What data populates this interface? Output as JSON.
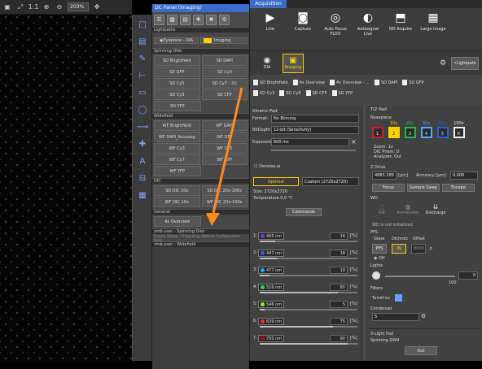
{
  "image_toolbar": {
    "zoom": "203%",
    "ratio": "1:1"
  },
  "dc_panel": {
    "title": "DC Panel (Imaging)",
    "groups": {
      "lightpaths": "Lightpaths",
      "spinning_disk": "Spinning Disk",
      "widefield": "Widefield",
      "dic": "DIC",
      "general": "General",
      "zmb_spinning": "zmb.user - Spinning Disk",
      "zmb_widefield": "zmb.user - Widefield"
    },
    "eyepiece": {
      "left": "Eyepiece - DIA",
      "right": "Imaging"
    },
    "spinning_buttons": [
      [
        "SD Brightfield",
        "SD DAPI"
      ],
      [
        "SD GFP",
        "SD Cy3"
      ],
      [
        "SD Cy5",
        "SD Cy7 - 2U"
      ],
      [
        "SD Cy3",
        "SD CFP"
      ],
      [
        "SD YFP",
        ""
      ]
    ],
    "widefield_buttons": [
      [
        "WF Brightfield",
        "WF DAPI"
      ],
      [
        "WF DAPI_focusing",
        "WF GFP"
      ],
      [
        "WF Cy3",
        "WF Cy5"
      ],
      [
        "WF Cy7",
        "WF CFP"
      ],
      [
        "WF YFP",
        ""
      ]
    ],
    "dic_buttons": [
      [
        "SD DIC 10x",
        "SD DIC 20x-100x"
      ],
      [
        "WF DIC 10x",
        "WF DIC 20x-100x"
      ]
    ],
    "general_buttons": [
      [
        "4x Overview",
        ""
      ]
    ],
    "empty_group_hint": "Empty Group - Drag-drop Optical Configuration here"
  },
  "acquisition": {
    "tab": "Acquisition",
    "buttons": [
      {
        "label": "Live",
        "icon": "play-icon"
      },
      {
        "label": "Capture",
        "icon": "camera-icon"
      },
      {
        "label": "Auto Focus FLUO",
        "icon": "autofocus-icon"
      },
      {
        "label": "Autosignal Live",
        "icon": "autosignal-icon"
      },
      {
        "label": "ND Acquire",
        "icon": "nd-acquire-icon"
      },
      {
        "label": "Large Image",
        "icon": "large-image-icon"
      }
    ],
    "ocl": [
      {
        "label": "DIA",
        "selected": false
      },
      {
        "label": "Imaging",
        "selected": true
      }
    ],
    "lightpath": "Lightpath",
    "macros_row1": [
      "SD Brightfield",
      "4x Overview",
      "4x Overview - ...",
      "SD DAPI",
      "SD GFP"
    ],
    "macros_row2": [
      "SD Cy3",
      "SD Cy5",
      "SD CFP",
      "SD YFP"
    ],
    "kinetix": {
      "title": "Kinetix Pad",
      "format_label": "Format:",
      "format_value": "No Binning",
      "bitdepth_label": "BitDepth",
      "bitdepth_value": "12-bit (Sensitivity)",
      "exposure_label": "Exposure",
      "exposure_value": "600 ms",
      "denoise": "Denoise.ai",
      "optimal": "Optimal",
      "custom": "Custom (2720x2720)",
      "size": "Size: 2720x2720",
      "temperature": "Temperature 0,0 °C",
      "commands": "Commands"
    },
    "lasers": [
      {
        "index": "1:",
        "name": "405 nm",
        "value": "16",
        "unit": "[%]",
        "color": "#7a33ff",
        "fill": 0.16
      },
      {
        "index": "2:",
        "name": "447 nm",
        "value": "18",
        "unit": "[%]",
        "color": "#3355ff",
        "fill": 0.18
      },
      {
        "index": "3:",
        "name": "477 nm",
        "value": "10",
        "unit": "[%]",
        "color": "#1ca9ff",
        "fill": 0.1
      },
      {
        "index": "4:",
        "name": "516 nm",
        "value": "80",
        "unit": "[%]",
        "color": "#22dd44",
        "fill": 0.8
      },
      {
        "index": "5:",
        "name": "546 nm",
        "value": "5",
        "unit": "[%]",
        "color": "#99ee22",
        "fill": 0.05
      },
      {
        "index": "6:",
        "name": "639 nm",
        "value": "75",
        "unit": "[%]",
        "color": "#ff2a2a",
        "fill": 0.75
      },
      {
        "index": "7:",
        "name": "750 nm",
        "value": "90",
        "unit": "[%]",
        "color": "#cc0000",
        "fill": 0.9
      }
    ],
    "ti2": {
      "title": "Ti2 Pad",
      "nosepiece": "Nosepiece",
      "objectives": [
        {
          "label": "4x",
          "num": "1",
          "color": "#cc2222"
        },
        {
          "label": "10x",
          "num": "2",
          "color": "#ffd000"
        },
        {
          "label": "20x",
          "num": "3",
          "color": "#22bb44"
        },
        {
          "label": "40x",
          "num": "4",
          "color": "#55aaff"
        },
        {
          "label": "60x",
          "num": "5",
          "color": "#2266dd"
        },
        {
          "label": "100x",
          "num": "6",
          "color": "#eeeeee"
        }
      ],
      "zoom": "Zoom: 1x",
      "dic_prism": "DIC Prism: D",
      "analyzer": "Analyzer: Out",
      "zdrive": "Z Drive",
      "z_value": "4883.180",
      "z_unit": "[µm]",
      "accuracy_label": "Accuracy [µm]:",
      "accuracy_value": "0.000",
      "focus": "Focus",
      "sample_swap": "Sample Swap",
      "escape": "Escape",
      "wd": "WD",
      "wd_not_init": "WD is not initialized",
      "wd_buttons": [
        "Init",
        "Immersion",
        "Discharge"
      ],
      "pfs": "PFS",
      "glass": "Glass",
      "dichroic": "Dichroic",
      "offset": "Offset",
      "pfs_btn": "PFS",
      "in_btn": "IN",
      "offset_val": "8000",
      "off": "Off",
      "lights": "Lights",
      "light_val": "0",
      "light_max": "100",
      "filters": "Filters",
      "filter_turret": "Turret-Lo",
      "condenser": "Condenser",
      "condenser_val": "5"
    },
    "xlight": {
      "title": "X-Light Pad",
      "spinning": "Spinning DW4",
      "out": "Out"
    }
  }
}
